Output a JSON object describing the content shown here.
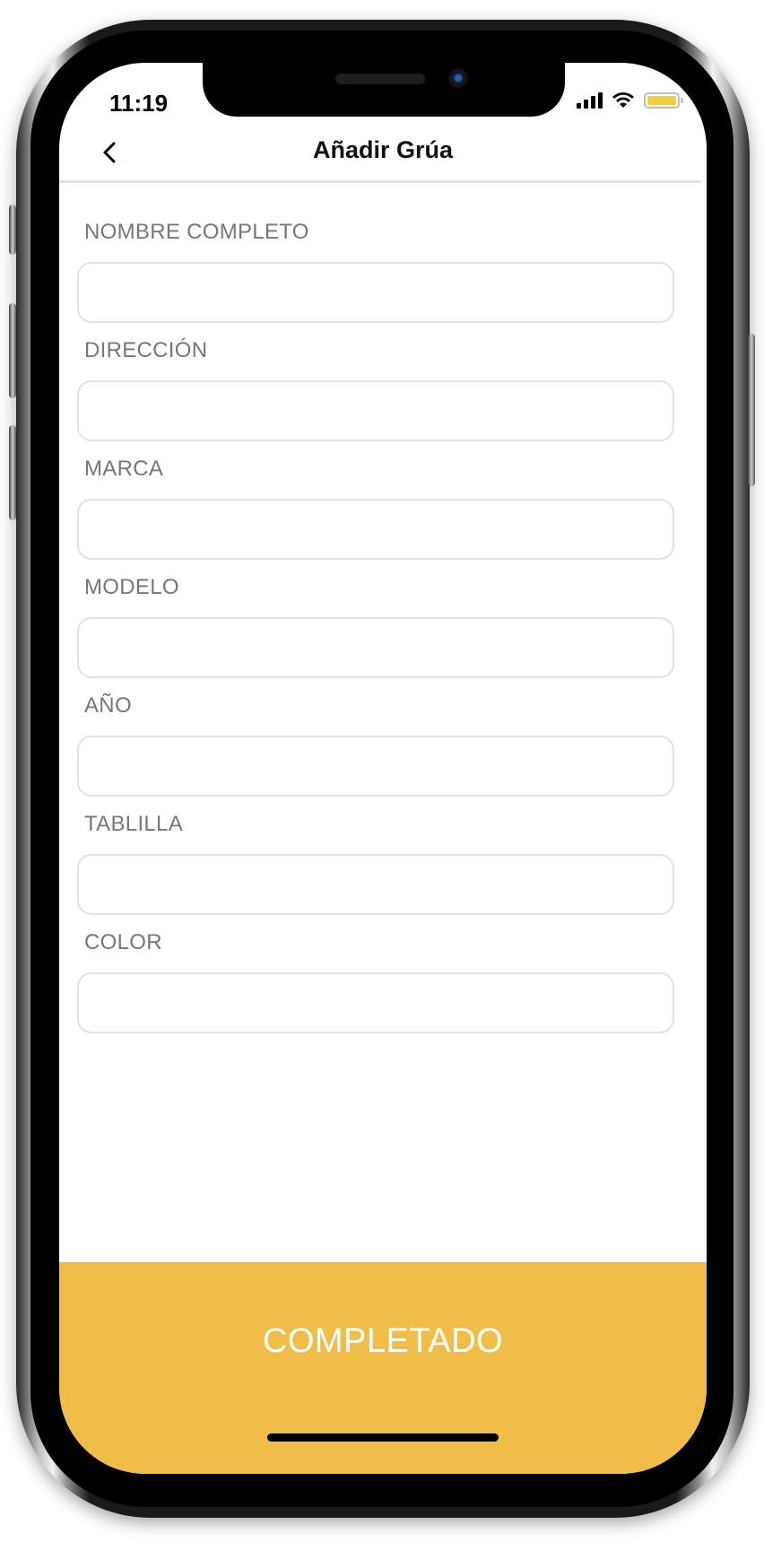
{
  "status_bar": {
    "time": "11:19",
    "battery_color": "#f5cf43"
  },
  "header": {
    "back_icon": "chevron-left-icon",
    "title": "Añadir Grúa"
  },
  "form": {
    "fields": [
      {
        "label": "NOMBRE COMPLETO",
        "value": "",
        "placeholder": ""
      },
      {
        "label": "DIRECCIÓN",
        "value": "",
        "placeholder": ""
      },
      {
        "label": "MARCA",
        "value": "",
        "placeholder": ""
      },
      {
        "label": "MODELO",
        "value": "",
        "placeholder": ""
      },
      {
        "label": "AÑO",
        "value": "",
        "placeholder": ""
      },
      {
        "label": "TABLILLA",
        "value": "",
        "placeholder": ""
      },
      {
        "label": "COLOR",
        "value": "",
        "placeholder": ""
      }
    ]
  },
  "footer": {
    "complete_label": "COMPLETADO",
    "button_color": "#f0bd49"
  }
}
